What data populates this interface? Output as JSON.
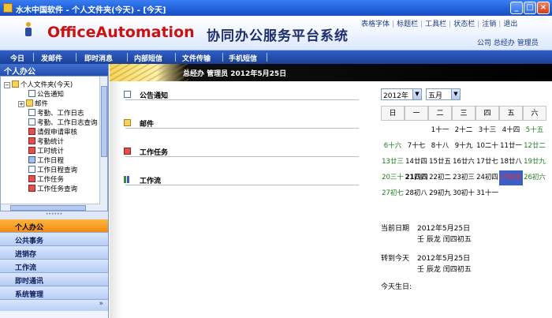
{
  "window": {
    "title": "水木中国软件 - 个人文件夹(今天) - [今天]",
    "buttons": {
      "minimize": "_",
      "maximize": "□",
      "close": "×"
    }
  },
  "header": {
    "brand": "OfficeAutomation",
    "brand_sub": "协同办公服务平台系统",
    "top_links": [
      "表格字体",
      "标题栏",
      "工具栏",
      "状态栏",
      "注销",
      "退出"
    ],
    "user_line": "公司 总经办 管理员"
  },
  "menu": [
    "今日",
    "发邮件",
    "即时消息",
    "内部短信",
    "文件传输",
    "手机短信"
  ],
  "sidebar": {
    "title": "个人办公",
    "tree": [
      {
        "label": "个人文件夹(今天)",
        "icon": "person-folder-icon"
      },
      {
        "label": "公告通知",
        "icon": "doc-icon"
      },
      {
        "label": "邮件",
        "icon": "folder-icon"
      },
      {
        "label": "考勤、工作日志",
        "icon": "doc-icon"
      },
      {
        "label": "考勤、工作日志查询",
        "icon": "doc-icon"
      },
      {
        "label": "请假申请审核",
        "icon": "check-icon"
      },
      {
        "label": "考勤统计",
        "icon": "chart-icon"
      },
      {
        "label": "工时统计",
        "icon": "chart-icon"
      },
      {
        "label": "工作日程",
        "icon": "tools-icon"
      },
      {
        "label": "工作日程查询",
        "icon": "doc-icon"
      },
      {
        "label": "工作任务",
        "icon": "check-icon"
      },
      {
        "label": "工作任务查询",
        "icon": "check-icon"
      }
    ],
    "nav": [
      "个人办公",
      "公共事务",
      "进销存",
      "工作流",
      "即时通讯",
      "系统管理"
    ],
    "more": "»"
  },
  "infobar": "总经办 管理员 2012年5月25日",
  "sections": [
    "公告通知",
    "邮件",
    "工作任务",
    "工作流"
  ],
  "calendar": {
    "year": "2012年",
    "month": "五月",
    "weekdays": [
      "日",
      "一",
      "二",
      "三",
      "四",
      "五",
      "六"
    ],
    "weeks": [
      [
        "",
        "",
        "1十一",
        "2十二",
        "3十三",
        "4十四",
        "5十五"
      ],
      [
        "6十六",
        "7十七",
        "8十八",
        "9十九",
        "10二十",
        "11廿一",
        "12廿二"
      ],
      [
        "13廿三",
        "14廿四",
        "15廿五",
        "16廿六",
        "17廿七",
        "18廿八",
        "19廿九"
      ],
      [
        "20三十",
        "21四四",
        "22初二",
        "23初三",
        "24初四",
        "25初五",
        "26初六"
      ],
      [
        "27初七",
        "28初八",
        "29初九",
        "30初十",
        "31十一",
        "",
        ""
      ]
    ],
    "today": "25初五"
  },
  "dateinfo": {
    "current_label": "当前日期",
    "current_date": "2012年5月25日",
    "current_lunar": "壬 辰龙 闰四初五",
    "goto_label": "转到今天",
    "goto_date": "2012年5月25日",
    "goto_lunar": "壬 辰龙 闰四初五",
    "birthday_label": "今天生日:"
  }
}
